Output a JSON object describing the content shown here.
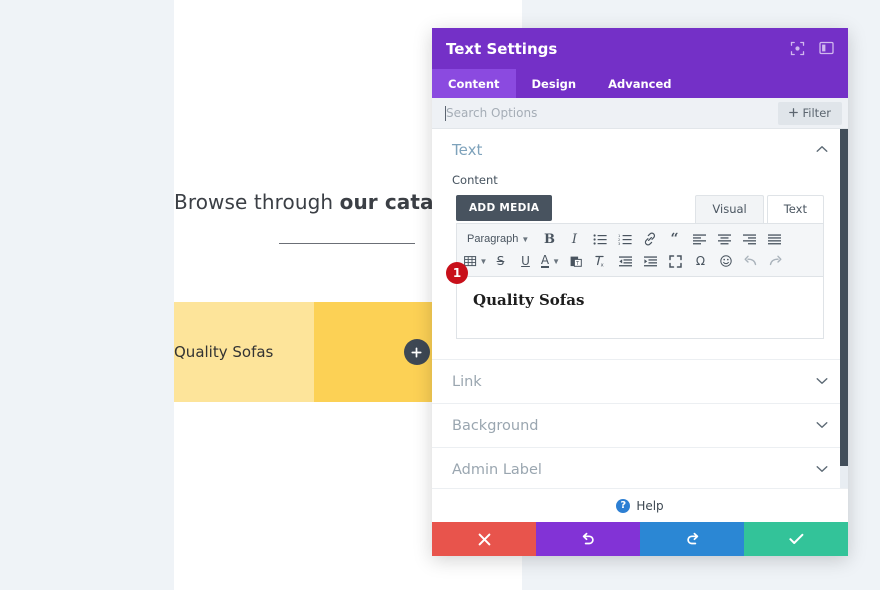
{
  "page": {
    "heading_prefix": "Browse through ",
    "heading_bold": "our catalo",
    "yellow_card_label": "Quality Sofas",
    "add_module_icon": "plus-icon"
  },
  "modal": {
    "title": "Text Settings",
    "header_icons": [
      {
        "name": "expand-icon"
      },
      {
        "name": "panel-layout-icon"
      }
    ],
    "tabs": [
      {
        "label": "Content",
        "active": true
      },
      {
        "label": "Design",
        "active": false
      },
      {
        "label": "Advanced",
        "active": false
      }
    ],
    "search": {
      "placeholder": "Search Options",
      "value": "",
      "filter_label": "Filter",
      "filter_icon": "plus-icon"
    },
    "section": {
      "title": "Text",
      "collapse_icon": "chevron-up-icon",
      "content_label": "Content"
    },
    "editor": {
      "add_media_label": "ADD MEDIA",
      "mode_tabs": [
        {
          "label": "Visual",
          "active": false
        },
        {
          "label": "Text",
          "active": true
        }
      ],
      "format_select": "Paragraph",
      "toolbar_row1": [
        "format-select",
        "bold-icon",
        "italic-icon",
        "bulleted-list-icon",
        "numbered-list-icon",
        "link-icon",
        "blockquote-icon",
        "align-left-icon",
        "align-center-icon",
        "align-right-icon",
        "align-justify-icon"
      ],
      "toolbar_row2": [
        "table-icon",
        "strikethrough-icon",
        "underline-icon",
        "text-color-icon",
        "paste-as-text-icon",
        "clear-formatting-icon",
        "outdent-icon",
        "indent-icon",
        "fullscreen-icon",
        "special-character-icon",
        "emoji-icon",
        "undo-icon",
        "redo-icon"
      ],
      "content_text": "Quality Sofas",
      "badge_number": "1"
    },
    "accordions": [
      {
        "label": "Link",
        "icon": "chevron-down-icon"
      },
      {
        "label": "Background",
        "icon": "chevron-down-icon"
      },
      {
        "label": "Admin Label",
        "icon": "chevron-down-icon"
      }
    ],
    "help": {
      "label": "Help",
      "icon": "question-mark-icon"
    },
    "footer_buttons": [
      {
        "name": "cancel-button",
        "icon": "close-x-icon",
        "color": "#e8544c"
      },
      {
        "name": "undo-button",
        "icon": "undo-arrow-icon",
        "color": "#8233d6"
      },
      {
        "name": "redo-button",
        "icon": "redo-arrow-icon",
        "color": "#2b87d4"
      },
      {
        "name": "save-button",
        "icon": "checkmark-icon",
        "color": "#33c399"
      }
    ]
  }
}
